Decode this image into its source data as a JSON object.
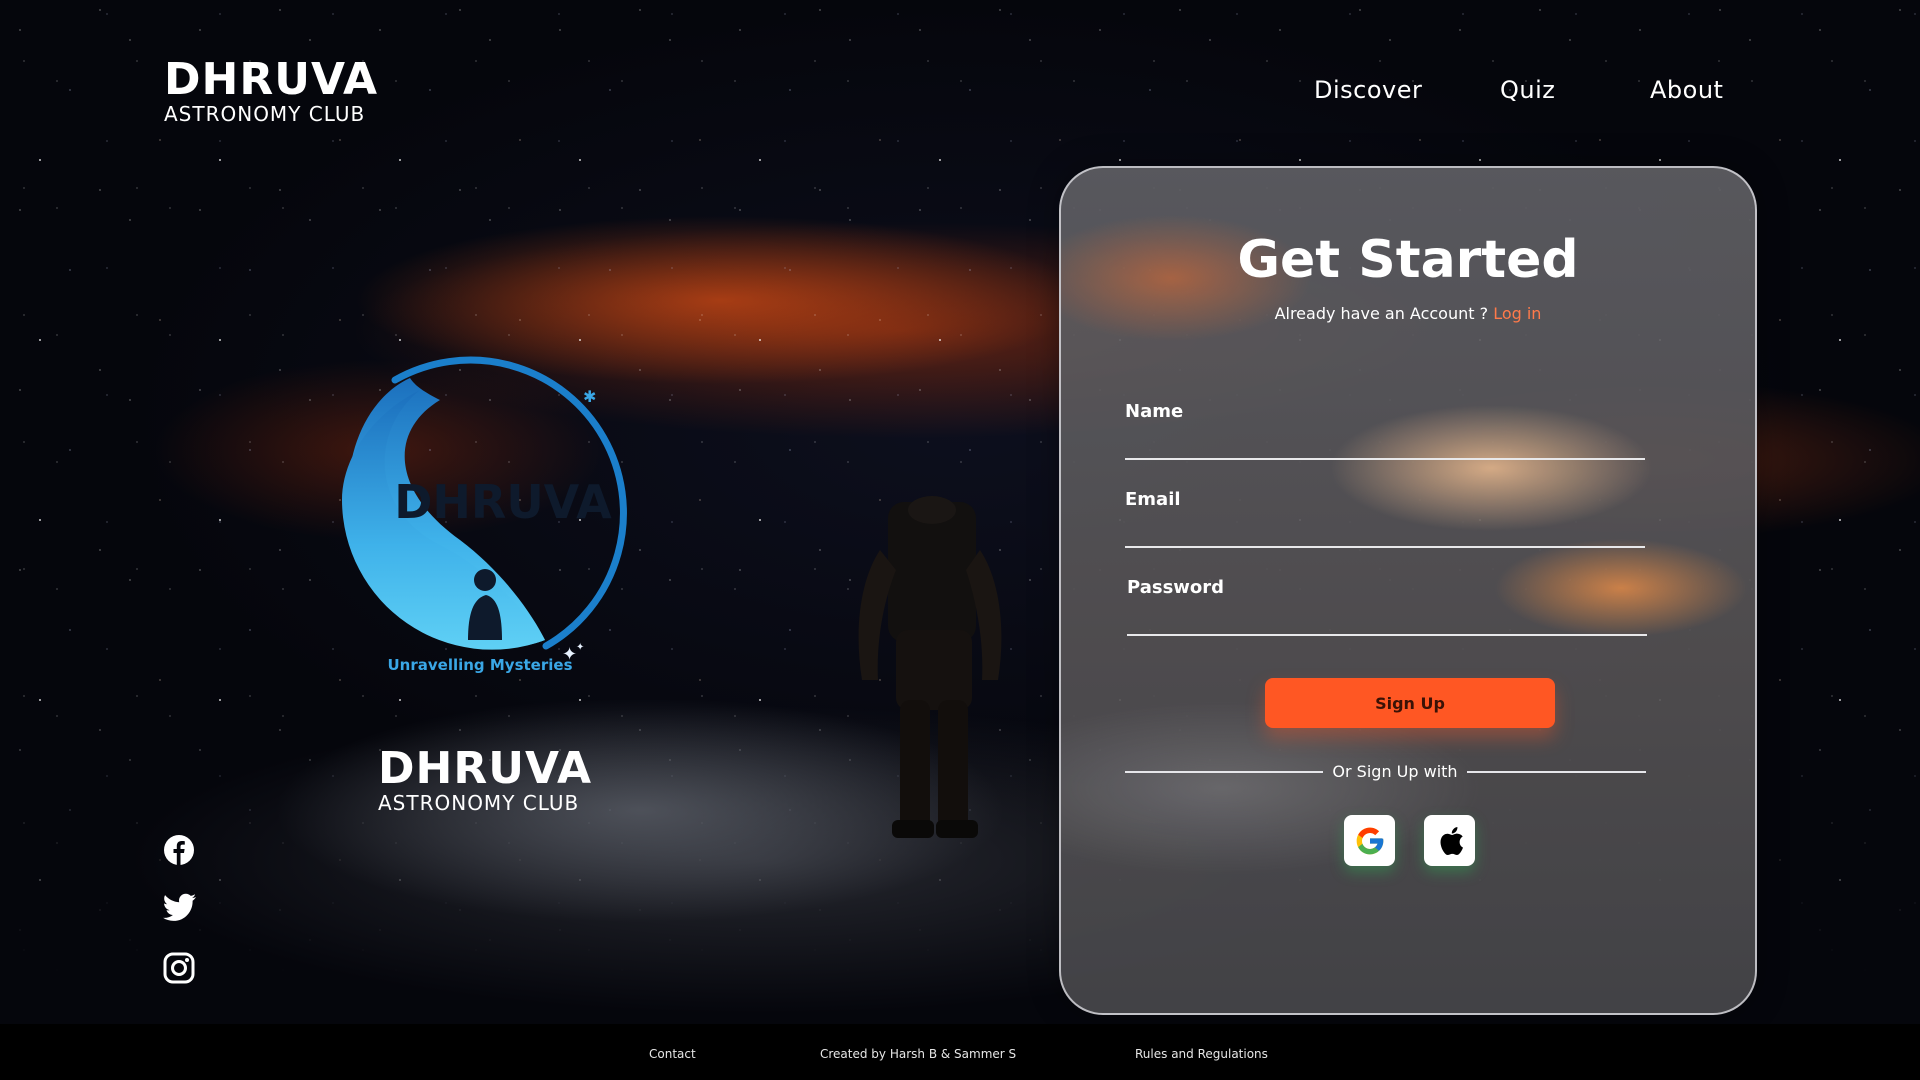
{
  "header": {
    "brand_title": "DHRUVA",
    "brand_subtitle": "ASTRONOMY CLUB",
    "nav": [
      {
        "label": "Discover"
      },
      {
        "label": "Quiz"
      },
      {
        "label": "About"
      }
    ]
  },
  "hero": {
    "logo_text": "DHRUVA",
    "logo_tagline": "Unravelling Mysteries",
    "brand_title": "DHRUVA",
    "brand_subtitle": "ASTRONOMY CLUB"
  },
  "socials": [
    {
      "icon": "facebook-icon"
    },
    {
      "icon": "twitter-icon"
    },
    {
      "icon": "instagram-icon"
    }
  ],
  "signup_card": {
    "title": "Get Started",
    "already_text": "Already have an Account ?",
    "login_link": "Log in",
    "fields": {
      "name_label": "Name",
      "name_value": "",
      "email_label": "Email",
      "email_value": "",
      "password_label": "Password",
      "password_value": ""
    },
    "submit_label": "Sign Up",
    "divider_text": "Or Sign Up with",
    "oauth": [
      {
        "icon": "google-icon"
      },
      {
        "icon": "apple-icon"
      }
    ]
  },
  "footer": {
    "contact": "Contact",
    "credits": "Created by Harsh B & Sammer S",
    "rules": "Rules and Regulations"
  },
  "colors": {
    "accent": "#ff5723",
    "link": "#ff7a4a",
    "logo_blue": "#3aa7e6"
  }
}
